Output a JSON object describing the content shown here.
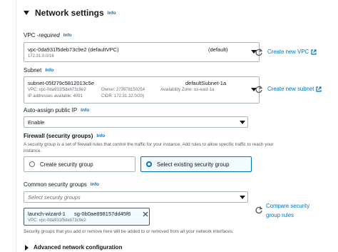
{
  "header": {
    "title": "Network settings",
    "info": "Info"
  },
  "vpc": {
    "label": "VPC - ",
    "required": "required",
    "info": "Info",
    "value": "vpc-0da931f5deb73c9e2 (defaultVPC)",
    "default_tag": "(default)",
    "cidr": "172.31.0.0/16",
    "create_link": "Create new VPC"
  },
  "subnet": {
    "label": "Subnet",
    "info": "Info",
    "id": "subnet-05f279c5812013c5e",
    "name": "defaultSubnet-1a",
    "vpc_meta": "VPC: vpc-0da931f5deb73c9e2",
    "owner": "Owner: 273978150254",
    "az": "Availability Zone: us-east-1a",
    "ips": "IP addresses available: 4091",
    "cidr": "CIDR: 172.31.32.0/20)",
    "create_link": "Create new subnet"
  },
  "public_ip": {
    "label": "Auto-assign public IP",
    "info": "Info",
    "value": "Enable"
  },
  "firewall": {
    "label": "Firewall (security groups)",
    "info": "Info",
    "description_line1": "A security group is a set of firewall rules that control the traffic for your instance. Add rules to allow specific traffic to reach your",
    "description_line2": "instance.",
    "option_create": "Create security group",
    "option_select": "Select existing security group"
  },
  "common_sg": {
    "label": "Common security groups",
    "info": "Info",
    "placeholder": "Select security groups",
    "token_name": "launch-wizard-1",
    "token_id": "sg-0b0ae898157dd45f6",
    "token_vpc": "VPC: vpc-0da931f5deb73c9e2",
    "compare_line1": "Compare security",
    "compare_line2": "group rules",
    "note": "Security groups that you add or remove here will be added to or removed from all your network interfaces."
  },
  "advanced": {
    "label": "Advanced network configuration"
  },
  "colors": {
    "link": "#0073bb",
    "border": "#aab7b8",
    "text": "#16191f",
    "muted": "#687078"
  }
}
